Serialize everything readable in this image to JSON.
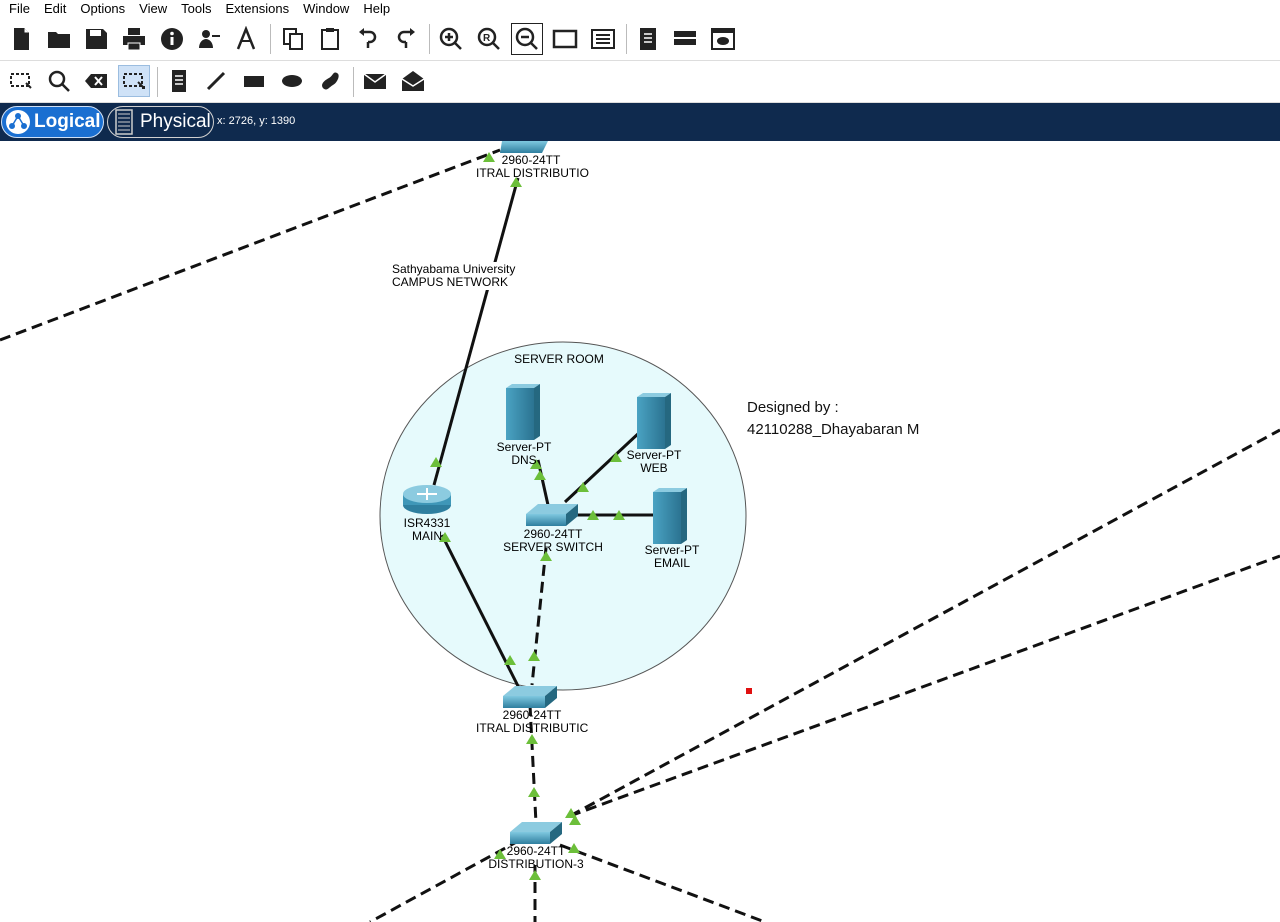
{
  "menu": [
    "File",
    "Edit",
    "Options",
    "View",
    "Tools",
    "Extensions",
    "Window",
    "Help"
  ],
  "tabs": {
    "logical": "Logical",
    "physical": "Physical"
  },
  "coords": "x: 2726, y: 1390",
  "canvas": {
    "note1": {
      "line1": "Sathyabama University",
      "line2": "CAMPUS NETWORK"
    },
    "cluster_title": "SERVER ROOM",
    "designer": {
      "line1": "Designed by :",
      "line2": "42110288_Dhayabaran M"
    },
    "devices": {
      "top_switch": {
        "model": "2960-24TT",
        "name": "ITRAL DISTRIBUTIO"
      },
      "dns": {
        "model": "Server-PT",
        "name": "DNS"
      },
      "web": {
        "model": "Server-PT",
        "name": "WEB"
      },
      "router": {
        "model": "ISR4331",
        "name": "MAIN"
      },
      "server_switch": {
        "model": "2960-24TT",
        "name": "SERVER SWITCH"
      },
      "email": {
        "model": "Server-PT",
        "name": "EMAIL"
      },
      "central_switch": {
        "model": "2960-24TT",
        "name": "ITRAL DISTRIBUTIC"
      },
      "dist3": {
        "model": "2960-24TT",
        "name": "DISTRIBUTION-3"
      }
    }
  },
  "colors": {
    "tabbar": "#0f2a4e",
    "logical_tab": "#1a6fd1",
    "cluster_fill": "#e6fafc",
    "link_up": "#6cbf3a",
    "device": "#3f97b8"
  }
}
